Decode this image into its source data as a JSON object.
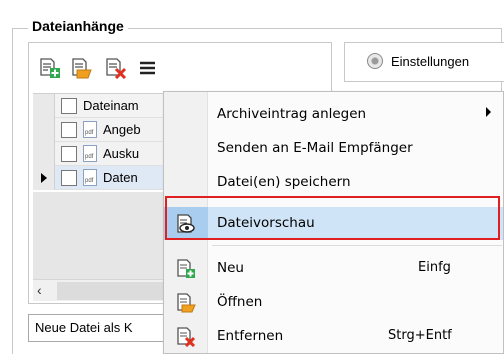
{
  "group": {
    "title": "Dateianhänge"
  },
  "toolbar": {
    "new_icon": "document-new-icon",
    "open_icon": "document-open-icon",
    "delete_icon": "document-delete-icon",
    "menu_icon": "hamburger-menu-icon"
  },
  "grid": {
    "header": "Dateinam",
    "rows": [
      {
        "name": "Angeb",
        "icon_label": "pdf"
      },
      {
        "name": "Ausku",
        "icon_label": "pdf"
      },
      {
        "name": "Daten",
        "icon_label": "pdf"
      }
    ]
  },
  "bottom_input": {
    "value": "Neue Datei als K"
  },
  "settings": {
    "label": "Einstellungen"
  },
  "context_menu": {
    "items": [
      {
        "label": "Archiveintrag anlegen",
        "has_submenu": true
      },
      {
        "label": "Senden an E-Mail Empfänger"
      },
      {
        "label": "Datei(en) speichern"
      },
      {
        "label": "Dateivorschau",
        "icon": "preview-eye-icon"
      },
      {
        "label": "Neu",
        "shortcut": "Einfg",
        "icon": "document-new-icon"
      },
      {
        "label": "Öffnen",
        "icon": "document-open-icon"
      },
      {
        "label": "Entfernen",
        "shortcut": "Strg+Entf",
        "icon": "document-delete-icon"
      }
    ]
  },
  "colors": {
    "highlight": "#cfe4f7",
    "annotation_box": "#e02020",
    "icon_green": "#2fa84f",
    "icon_orange": "#f0a020",
    "icon_red": "#e03020"
  }
}
